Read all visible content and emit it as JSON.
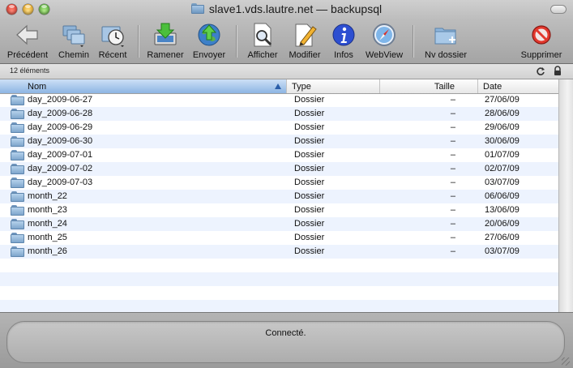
{
  "window": {
    "title": "slave1.vds.lautre.net — backupsql"
  },
  "toolbar": {
    "back": "Précédent",
    "path": "Chemin",
    "recent": "Récent",
    "download": "Ramener",
    "upload": "Envoyer",
    "view": "Afficher",
    "edit": "Modifier",
    "info": "Infos",
    "webview": "WebView",
    "new_folder": "Nv dossier",
    "delete": "Supprimer"
  },
  "strip": {
    "count": "12 éléments"
  },
  "table": {
    "columns": [
      "Nom",
      "Type",
      "Taille",
      "Date"
    ],
    "rows": [
      {
        "name": "day_2009-06-27",
        "type": "Dossier",
        "size": "–",
        "date": "27/06/09"
      },
      {
        "name": "day_2009-06-28",
        "type": "Dossier",
        "size": "–",
        "date": "28/06/09"
      },
      {
        "name": "day_2009-06-29",
        "type": "Dossier",
        "size": "–",
        "date": "29/06/09"
      },
      {
        "name": "day_2009-06-30",
        "type": "Dossier",
        "size": "–",
        "date": "30/06/09"
      },
      {
        "name": "day_2009-07-01",
        "type": "Dossier",
        "size": "–",
        "date": "01/07/09"
      },
      {
        "name": "day_2009-07-02",
        "type": "Dossier",
        "size": "–",
        "date": "02/07/09"
      },
      {
        "name": "day_2009-07-03",
        "type": "Dossier",
        "size": "–",
        "date": "03/07/09"
      },
      {
        "name": "month_22",
        "type": "Dossier",
        "size": "–",
        "date": "06/06/09"
      },
      {
        "name": "month_23",
        "type": "Dossier",
        "size": "–",
        "date": "13/06/09"
      },
      {
        "name": "month_24",
        "type": "Dossier",
        "size": "–",
        "date": "20/06/09"
      },
      {
        "name": "month_25",
        "type": "Dossier",
        "size": "–",
        "date": "27/06/09"
      },
      {
        "name": "month_26",
        "type": "Dossier",
        "size": "–",
        "date": "03/07/09"
      }
    ]
  },
  "status": {
    "text": "Connecté."
  }
}
